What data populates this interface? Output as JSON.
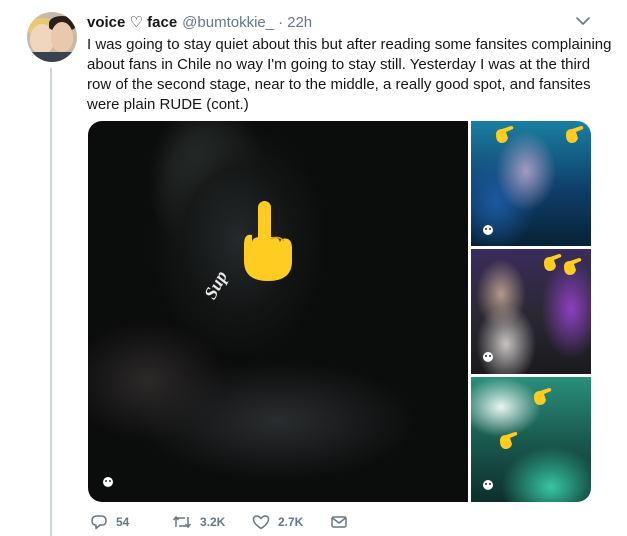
{
  "tweet": {
    "display_name": "voice ♡ face",
    "handle": "@bumtokkie_",
    "separator": "·",
    "time": "22h",
    "text_lines": [
      "I was going to stay quiet about this but after reading some fansites complaining",
      "about fans in Chile no way I'm going to stay still. Yesterday I was at the third",
      "row of the second stage, near to the middle, a really good spot, and fansites",
      "were plain RUDE (cont.)"
    ]
  },
  "media": {
    "main_photo_text": "Sup",
    "emoji_overlay": "middle-finger-emoji"
  },
  "actions": {
    "reply_count": "54",
    "retweet_count": "3.2K",
    "like_count": "2.7K"
  },
  "icons": {
    "reply": "reply-icon",
    "retweet": "retweet-icon",
    "like": "heart-icon",
    "message": "envelope-icon",
    "menu": "chevron-down-icon"
  },
  "colors": {
    "text": "#14171a",
    "muted": "#657786",
    "thread_line": "#ccd6dd",
    "emoji_yellow": "#ffcc22"
  }
}
